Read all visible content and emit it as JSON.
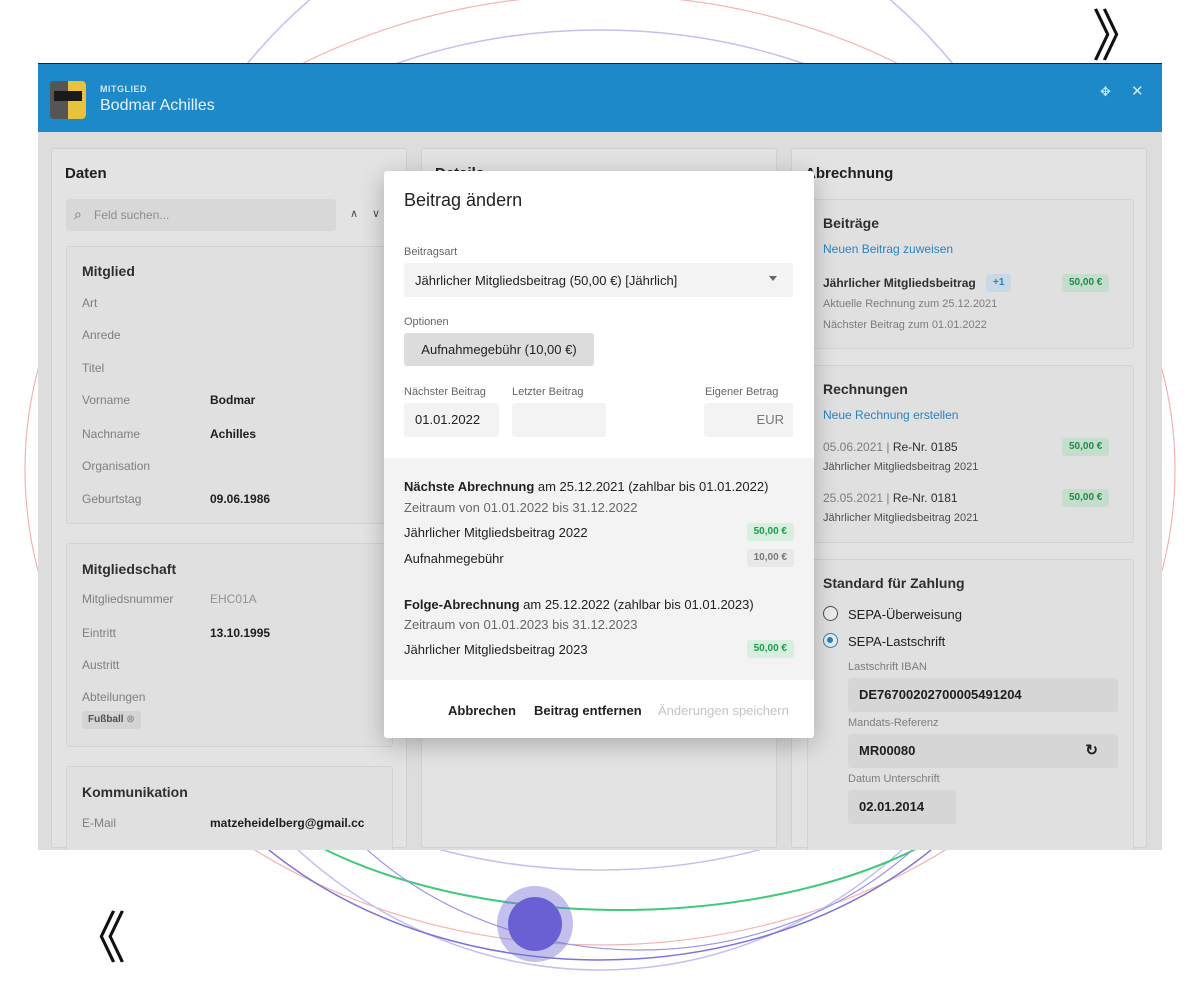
{
  "header": {
    "kicker": "MITGLIED",
    "member_name": "Bodmar Achilles"
  },
  "daten": {
    "title": "Daten",
    "search_placeholder": "Feld suchen...",
    "mitglied": {
      "title": "Mitglied",
      "rows": [
        {
          "label": "Art",
          "value": ""
        },
        {
          "label": "Anrede",
          "value": ""
        },
        {
          "label": "Titel",
          "value": ""
        },
        {
          "label": "Vorname",
          "value": "Bodmar"
        },
        {
          "label": "Nachname",
          "value": "Achilles"
        },
        {
          "label": "Organisation",
          "value": ""
        },
        {
          "label": "Geburtstag",
          "value": "09.06.1986"
        }
      ]
    },
    "mitgliedschaft": {
      "title": "Mitgliedschaft",
      "rows": [
        {
          "label": "Mitgliedsnummer",
          "value": "EHC01A"
        },
        {
          "label": "Eintritt",
          "value": "13.10.1995"
        },
        {
          "label": "Austritt",
          "value": ""
        },
        {
          "label": "Abteilungen",
          "value": ""
        }
      ],
      "tag": "Fußball"
    },
    "kommunikation": {
      "title": "Kommunikation",
      "rows": [
        {
          "label": "E-Mail",
          "value": "matzeheidelberg@gmail.cc"
        }
      ]
    }
  },
  "details": {
    "title": "Details"
  },
  "abrechnung": {
    "title": "Abrechnung",
    "beitraege": {
      "title": "Beiträge",
      "link": "Neuen Beitrag zuweisen",
      "item": "Jährlicher Mitgliedsbeitrag",
      "extra": "+1",
      "amount": "50,00 €",
      "line1": "Aktuelle Rechnung zum 25.12.2021",
      "line2": "Nächster Beitrag zum 01.01.2022"
    },
    "rechnungen": {
      "title": "Rechnungen",
      "link": "Neue Rechnung erstellen",
      "items": [
        {
          "date": "05.06.2021 | ",
          "nr": "Re-Nr. 0185",
          "desc": "Jährlicher Mitgliedsbeitrag 2021",
          "amount": "50,00 €"
        },
        {
          "date": "25.05.2021 | ",
          "nr": "Re-Nr. 0181",
          "desc": "Jährlicher Mitgliedsbeitrag 2021",
          "amount": "50,00 €"
        }
      ]
    },
    "zahlung": {
      "title": "Standard für Zahlung",
      "option1": "SEPA-Überweisung",
      "option2": "SEPA-Lastschrift",
      "iban_label": "Lastschrift IBAN",
      "iban": "DE76700202700005491204",
      "mandat_label": "Mandats-Referenz",
      "mandat": "MR00080",
      "datum_label": "Datum Unterschrift",
      "datum": "02.01.2014"
    }
  },
  "modal": {
    "title": "Beitrag ändern",
    "beitragsart_label": "Beitragsart",
    "beitragsart_value": "Jährlicher Mitgliedsbeitrag (50,00 €) [Jährlich]",
    "optionen_label": "Optionen",
    "option_button": "Aufnahmegebühr (10,00 €)",
    "naechster_label": "Nächster Beitrag",
    "letzter_label": "Letzter Beitrag",
    "eigener_label": "Eigener Betrag",
    "naechster_value": "01.01.2022",
    "letzter_value": "",
    "eigener_suffix": "EUR",
    "next_bold": "Nächste Abrechnung",
    "next_rest": " am 25.12.2021 (zahlbar bis 01.01.2022)",
    "next_period": "Zeitraum von 01.01.2022 bis 31.12.2022",
    "next_item1": "Jährlicher Mitgliedsbeitrag 2022",
    "next_item1_amount": "50,00 €",
    "next_item2": "Aufnahmegebühr",
    "next_item2_amount": "10,00 €",
    "follow_bold": "Folge-Abrechnung",
    "follow_rest": " am 25.12.2022 (zahlbar bis 01.01.2023)",
    "follow_period": "Zeitraum von 01.01.2023 bis 31.12.2023",
    "follow_item1": "Jährlicher Mitgliedsbeitrag 2023",
    "follow_item1_amount": "50,00 €",
    "cancel": "Abbrechen",
    "remove": "Beitrag entfernen",
    "save": "Änderungen speichern"
  }
}
